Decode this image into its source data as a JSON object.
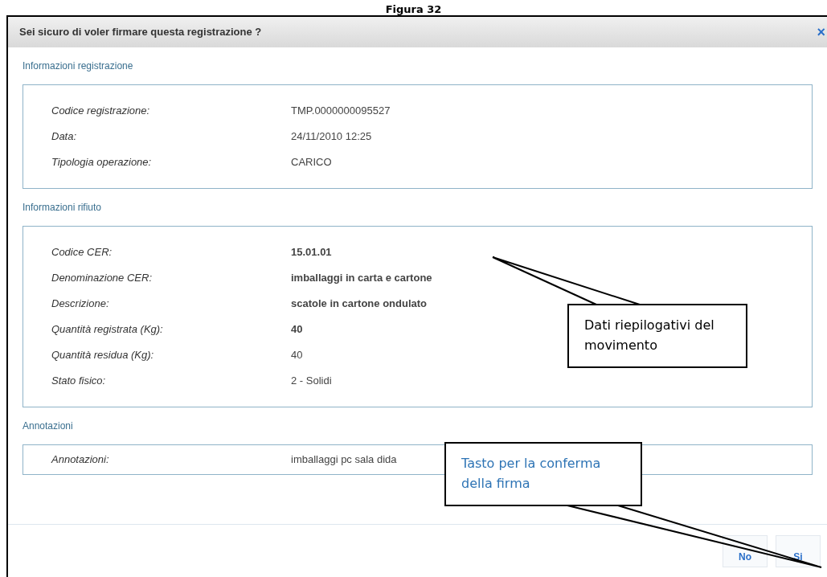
{
  "caption": "Figura 32",
  "dialog": {
    "title": "Sei sicuro di voler firmare questa registrazione ?",
    "close": "×"
  },
  "sections": [
    {
      "heading": "Informazioni registrazione",
      "rows": [
        {
          "label": "Codice registrazione:",
          "value": "TMP.0000000095527",
          "bold": false
        },
        {
          "label": "Data:",
          "value": "24/11/2010 12:25",
          "bold": false
        },
        {
          "label": "Tipologia operazione:",
          "value": "CARICO",
          "bold": false
        }
      ]
    },
    {
      "heading": "Informazioni rifiuto",
      "rows": [
        {
          "label": "Codice CER:",
          "value": "15.01.01",
          "bold": true
        },
        {
          "label": "Denominazione CER:",
          "value": "imballaggi in carta e cartone",
          "bold": true
        },
        {
          "label": "Descrizione:",
          "value": "scatole in cartone ondulato",
          "bold": true
        },
        {
          "label": "Quantità registrata (Kg):",
          "value": "40",
          "bold": true
        },
        {
          "label": "Quantità residua (Kg):",
          "value": "40",
          "bold": false
        },
        {
          "label": "Stato fisico:",
          "value": "2 - Solidi",
          "bold": false
        }
      ]
    },
    {
      "heading": "Annotazioni",
      "rows": [
        {
          "label": "Annotazioni:",
          "value": "imballaggi pc sala dida",
          "bold": false
        }
      ]
    }
  ],
  "buttons": [
    "No",
    "Si"
  ],
  "callouts": [
    {
      "text": "Dati riepilogativi del movimento",
      "kind": "black"
    },
    {
      "text": "Tasto per la conferma della firma",
      "kind": "blue"
    }
  ]
}
